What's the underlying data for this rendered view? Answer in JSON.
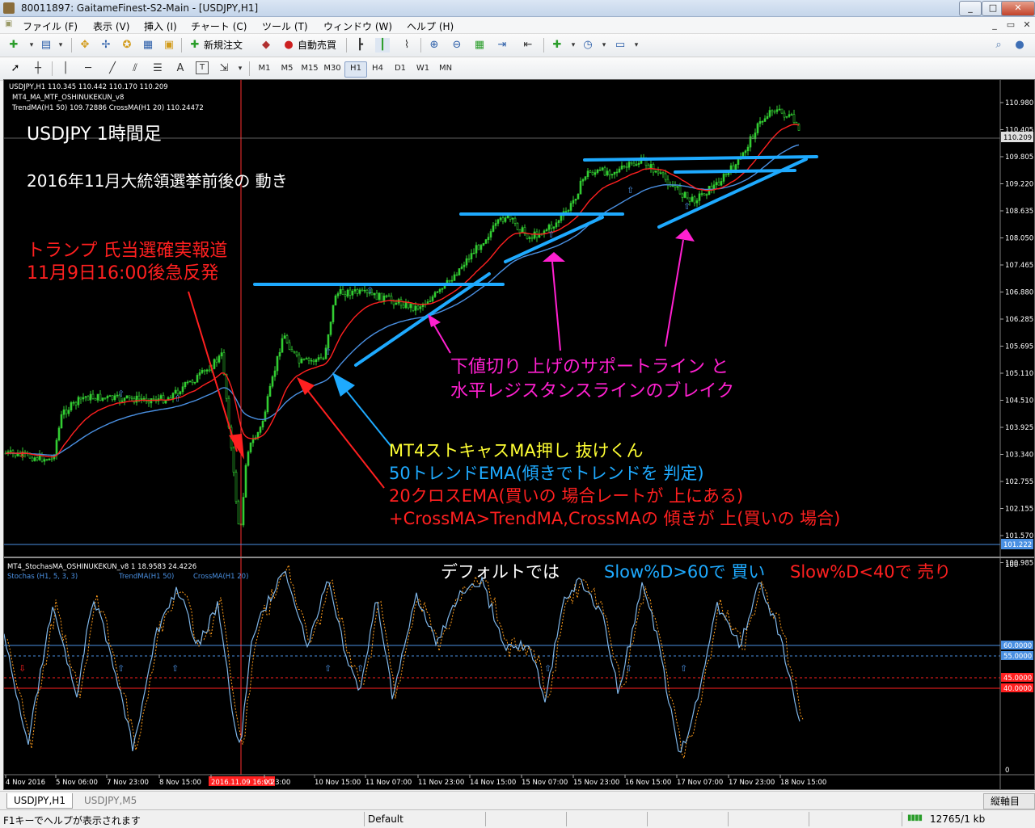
{
  "window": {
    "title": "80011897: GaitameFinest-S2-Main - [USDJPY,H1]",
    "min": "_",
    "max": "□",
    "close": "✕"
  },
  "menu": [
    {
      "label": "ファイル (F)"
    },
    {
      "label": "表示 (V)"
    },
    {
      "label": "挿入 (I)"
    },
    {
      "label": "チャート (C)"
    },
    {
      "label": "ツール (T)"
    },
    {
      "label": "ウィンドウ (W)"
    },
    {
      "label": "ヘルプ (H)"
    }
  ],
  "toolbar": {
    "new_order": "新規注文",
    "auto_trade": "自動売買"
  },
  "drawbar": {
    "text_tool": "A",
    "label_tool": "T"
  },
  "timeframes": [
    "M1",
    "M5",
    "M15",
    "M30",
    "H1",
    "H4",
    "D1",
    "W1",
    "MN"
  ],
  "timeframe_active": "H1",
  "main": {
    "header": "USDJPY,H1  110.345 110.442 110.170 110.209",
    "indicator1": "MT4_MA_MTF_OSHINUKEKUN_v8",
    "indicator2": "TrendMA(H1 50) 109.72886 CrossMA(H1 20) 110.24472",
    "title": "USDJPY 1時間足",
    "subtitle": "2016年11月大統領選挙前後の 動き",
    "annot_red1": "トランプ 氏当選確実報道",
    "annot_red2": "11月9日16:00後急反発",
    "annot_mag1": "下値切り 上げのサポートライン と",
    "annot_mag2": "水平レジスタンスラインのブレイク",
    "annot_yellow": "MT4ストキャスMA押し 抜けくん",
    "annot_blue": "50トレンドEMA(傾きでトレンドを 判定)",
    "annot_red3": "20クロスEMA(買いの 場合レートが 上にある)",
    "annot_red4": "+CrossMA>TrendMA,CrossMAの 傾きが 上(買いの 場合)",
    "price_ticks": [
      "110.980",
      "110.405",
      "109.805",
      "109.220",
      "108.635",
      "108.050",
      "107.465",
      "106.880",
      "106.285",
      "105.695",
      "105.110",
      "104.510",
      "103.925",
      "103.340",
      "102.755",
      "102.155",
      "101.570",
      "100.985"
    ],
    "current_price": "110.209",
    "low_line_price": "101.222"
  },
  "sub": {
    "header": "MT4_StochasMA_OSHINUKEKUN_v8 1 18.9583 24.4226",
    "legend1": "Stochas (H1, 5, 3, 3)",
    "legend2": "TrendMA(H1 50)",
    "legend3": "CrossMA(H1 20)",
    "note_white": "デフォルトでは",
    "note_blue": "Slow%D>60で 買い",
    "note_red": "Slow%D<40で 売り",
    "levels": [
      "60.0000",
      "55.0000",
      "45.0000",
      "40.0000"
    ],
    "scale_top": "100",
    "scale_bottom": "0"
  },
  "time_axis": [
    "4 Nov 2016",
    "5 Nov 06:00",
    "7 Nov 23:00",
    "8 Nov 15:00",
    "2016.11.09 16:00",
    "v 23:00",
    "10 Nov 15:00",
    "11 Nov 07:00",
    "11 Nov 23:00",
    "14 Nov 15:00",
    "15 Nov 07:00",
    "15 Nov 23:00",
    "16 Nov 15:00",
    "17 Nov 07:00",
    "17 Nov 23:00",
    "18 Nov 15:00"
  ],
  "tabs": [
    {
      "label": "USDJPY,H1",
      "active": true
    },
    {
      "label": "USDJPY,M5",
      "active": false
    }
  ],
  "tab_right": "縦軸目盛",
  "status": {
    "help": "F1キーでヘルプが表示されます",
    "profile": "Default",
    "traffic": "12765/1 kb"
  },
  "colors": {
    "bg": "#000000",
    "bull": "#32cd32",
    "cross_ma": "#ff2020",
    "trend_ma": "#4a90e2",
    "line_cyan": "#1eaaff",
    "magenta": "#ff20d0",
    "yellow": "#ffff33"
  }
}
